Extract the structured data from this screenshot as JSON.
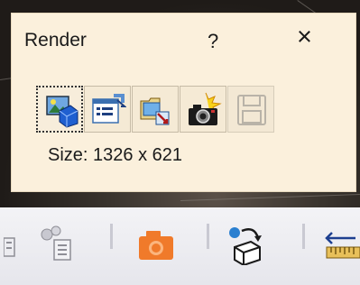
{
  "palette": {
    "title": "Render",
    "help_label": "?",
    "close_label": "×",
    "size_text": "Size: 1326 x 621",
    "tools": [
      {
        "name": "render-shooting-icon",
        "selected": true,
        "enabled": true
      },
      {
        "name": "render-settings-icon",
        "selected": false,
        "enabled": true
      },
      {
        "name": "render-output-icon",
        "selected": false,
        "enabled": true
      },
      {
        "name": "render-snapshot-icon",
        "selected": false,
        "enabled": true
      },
      {
        "name": "save-disk-icon",
        "selected": false,
        "enabled": false
      }
    ]
  },
  "toolbar": {
    "icons": [
      "catalog-icon",
      "camera-icon",
      "move-object-icon",
      "ruler-measure-icon"
    ]
  },
  "colors": {
    "palette_bg": "#fbf0dc",
    "toolbar_bg": "#eeeef2",
    "camera_orange": "#f07a2a"
  }
}
